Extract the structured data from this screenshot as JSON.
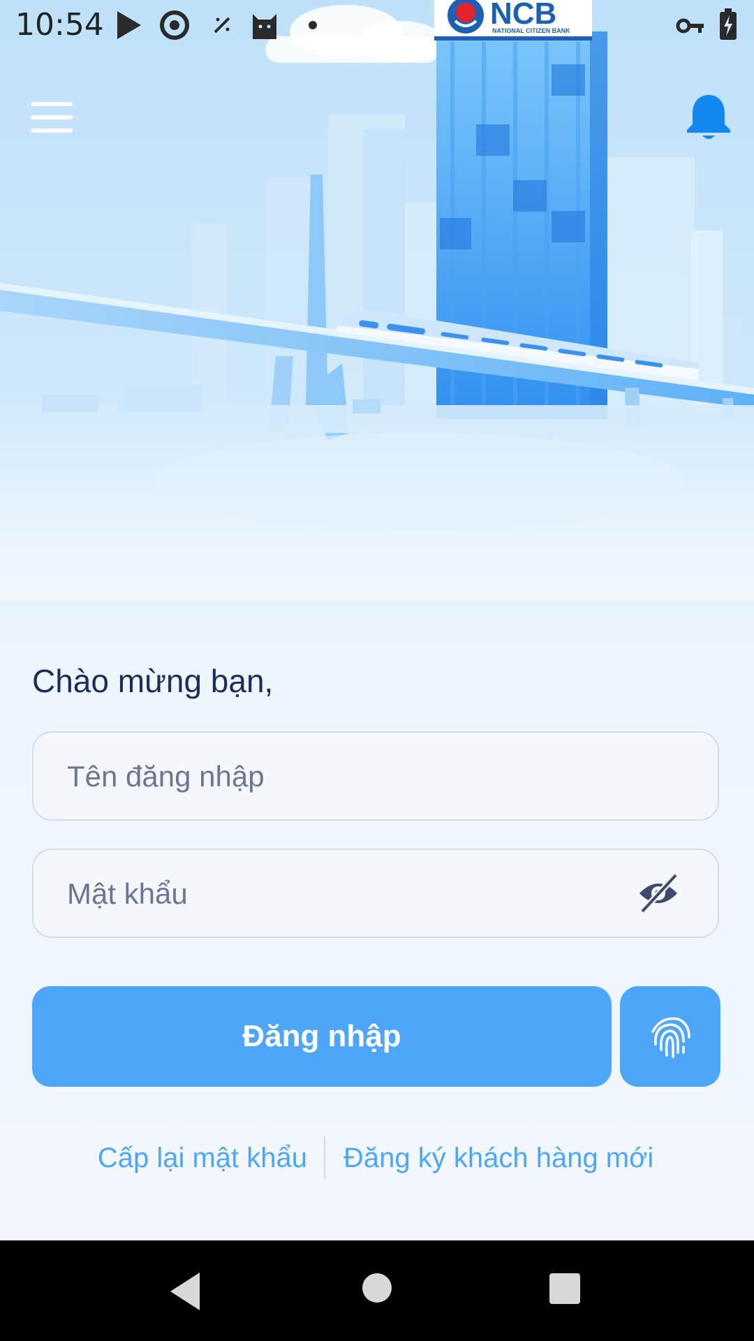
{
  "status_bar": {
    "time": "10:54",
    "icons": [
      "play-store-icon",
      "sync-icon",
      "magic-wand-icon",
      "cat-icon",
      "notification-dot-icon",
      "vpn-key-icon",
      "battery-charging-icon"
    ]
  },
  "header": {
    "menu_icon": "hamburger-menu-icon",
    "notification_icon": "bell-icon",
    "logo_text": "NCB",
    "logo_subtext": "NATIONAL CITIZEN BANK"
  },
  "login": {
    "welcome": "Chào mừng bạn,",
    "username_placeholder": "Tên đăng nhập",
    "username_value": "",
    "password_placeholder": "Mật khẩu",
    "password_value": "",
    "password_toggle_icon": "eye-off-icon",
    "login_button": "Đăng nhập",
    "biometric_icon": "fingerprint-icon",
    "forgot_password": "Cấp lại mật khẩu",
    "register": "Đăng ký khách hàng mới"
  },
  "nav_bar": {
    "back": "back-triangle-icon",
    "home": "home-circle-icon",
    "recents": "recents-square-icon"
  },
  "colors": {
    "accent": "#4ea6fb",
    "title": "#1e2b5e",
    "bell": "#1288f0"
  }
}
